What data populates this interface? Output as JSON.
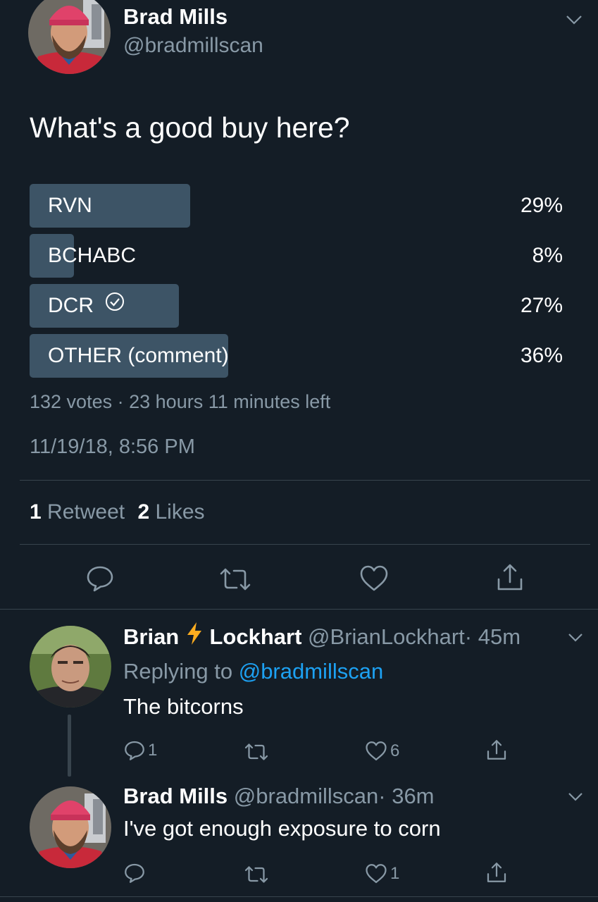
{
  "tweet": {
    "author_name": "Brad Mills",
    "author_handle": "@bradmillscan",
    "text": "What's a good buy here?",
    "poll": {
      "options": [
        {
          "label": "RVN",
          "percent_text": "29%",
          "percent": 29
        },
        {
          "label": "BCHABC",
          "percent_text": "8%",
          "percent": 8
        },
        {
          "label": "DCR",
          "percent_text": "27%",
          "percent": 27,
          "selected": true
        },
        {
          "label": "OTHER (comment)",
          "percent_text": "36%",
          "percent": 36
        }
      ],
      "votes": "132 votes",
      "separator": "·",
      "time_left": "23 hours 11 minutes left"
    },
    "timestamp": "11/19/18, 8:56 PM",
    "stats": {
      "retweet_count": "1",
      "retweet_label": "Retweet",
      "like_count": "2",
      "like_label": "Likes"
    },
    "icons": [
      "reply-icon",
      "retweet-icon",
      "like-icon",
      "share-icon",
      "chevron-down-icon"
    ]
  },
  "replies": [
    {
      "name_part1": "Brian",
      "name_part2": "Lockhart",
      "handle": "@BrianLockhart",
      "time": "· 45m",
      "replying_prefix": "Replying to",
      "replying_handle": "@bradmillscan",
      "text": "The bitcorns",
      "reply_count": "1",
      "like_count": "6"
    },
    {
      "name": "Brad Mills",
      "handle": "@bradmillscan",
      "time": "· 36m",
      "text": "I've got enough exposure to corn",
      "like_count": "1"
    }
  ],
  "colors": {
    "background": "#141d26",
    "poll_bar": "#3d5466",
    "secondary_text": "#8899a6",
    "link": "#1da1f2",
    "lightning": "#ffad1f"
  }
}
